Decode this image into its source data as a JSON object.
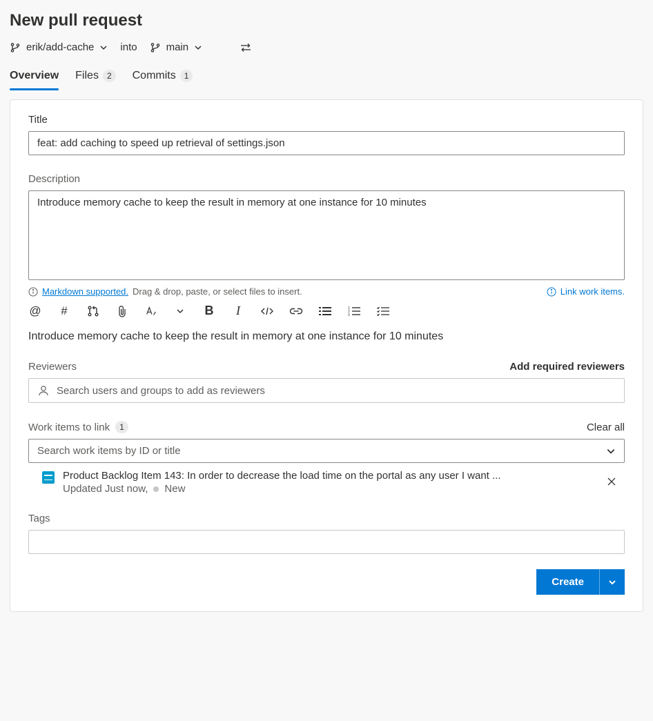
{
  "page": {
    "title": "New pull request"
  },
  "branchRow": {
    "source": "erik/add-cache",
    "into": "into",
    "target": "main"
  },
  "tabs": {
    "overview": {
      "label": "Overview"
    },
    "files": {
      "label": "Files",
      "count": "2"
    },
    "commits": {
      "label": "Commits",
      "count": "1"
    }
  },
  "titleSection": {
    "label": "Title",
    "value": "feat: add caching to speed up retrieval of settings.json"
  },
  "descriptionSection": {
    "label": "Description",
    "value": "Introduce memory cache to keep the result in memory at one instance for 10 minutes"
  },
  "hints": {
    "markdownLink": "Markdown supported.",
    "dragDrop": "Drag & drop, paste, or select files to insert.",
    "linkWorkItems": "Link work items."
  },
  "preview": "Introduce memory cache to keep the result in memory at one instance for 10 minutes",
  "reviewers": {
    "label": "Reviewers",
    "addRequired": "Add required reviewers",
    "placeholder": "Search users and groups to add as reviewers"
  },
  "workItems": {
    "label": "Work items to link",
    "count": "1",
    "clearAll": "Clear all",
    "placeholder": "Search work items by ID or title",
    "item": {
      "title": "Product Backlog Item 143: In order to decrease the load time on the portal as any user I want ...",
      "updated": "Updated Just now,",
      "state": "New"
    }
  },
  "tags": {
    "label": "Tags"
  },
  "footer": {
    "create": "Create"
  }
}
